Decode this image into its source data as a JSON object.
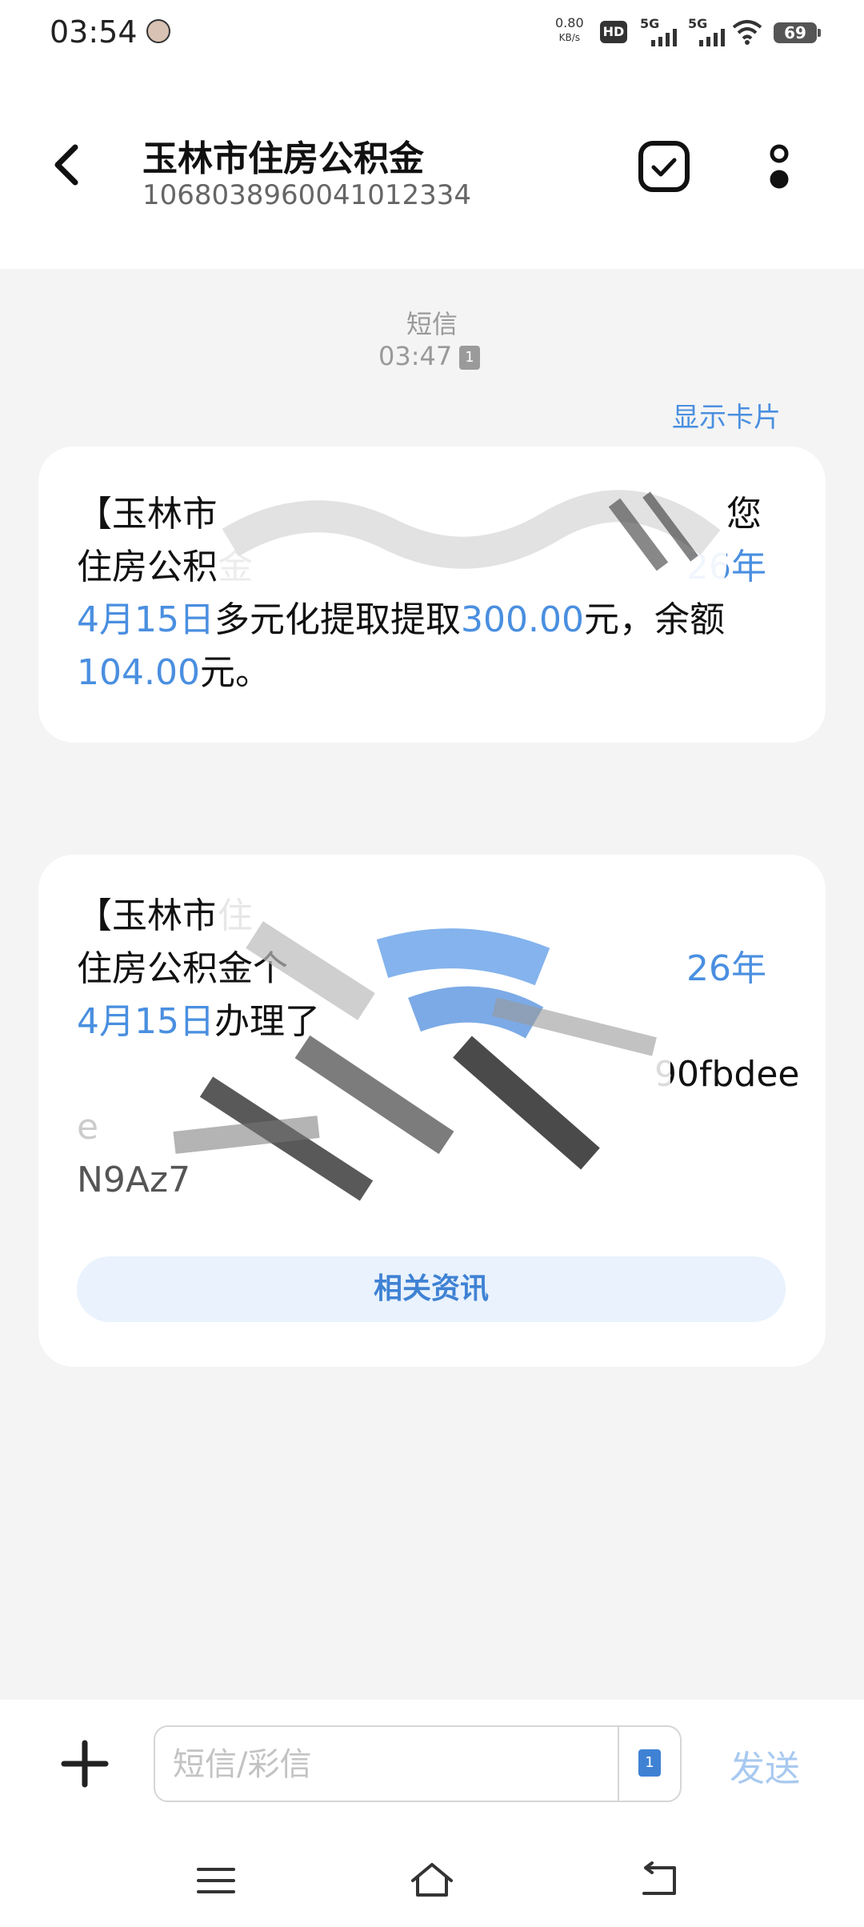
{
  "status_bar": {
    "time": "03:54",
    "net_speed_value": "0.80",
    "net_speed_unit": "KB/s",
    "hd_label": "HD",
    "signal1_label": "5G",
    "signal2_label": "5G",
    "battery": "69"
  },
  "header": {
    "title": "玉林市住房公积金",
    "phone_number": "106803896004101​2334"
  },
  "conversation": {
    "channel_label": "短信",
    "time_label": "03:47",
    "sim_number": "1",
    "show_card_label": "显示卡片",
    "message1": {
      "line1_start": "【玉林市",
      "line1_end": "您",
      "line2_start": "住房公积金",
      "line2_end": "26年",
      "line3_date": "4月15日",
      "line3_text1": "多元化提取提取",
      "line3_amount": "300.00",
      "line3_text2": "元，余额",
      "line4_balance": "104.00",
      "line4_text": "元。"
    },
    "message2": {
      "line1_start": "【玉林市住",
      "line2_start": "住房公积金个",
      "line2_end": "26年",
      "line3_date": "4月15日",
      "line3_text": "办理了",
      "line4_end": "90fbdee",
      "line5_start": "e",
      "line6_start": "N9Az7",
      "related_label": "相关资讯"
    }
  },
  "input_bar": {
    "placeholder": "短信/彩信",
    "sim_number": "1",
    "send_label": "发送"
  },
  "colors": {
    "accent": "#4a8fe0",
    "background": "#f4f4f4",
    "bubble": "#ffffff"
  }
}
